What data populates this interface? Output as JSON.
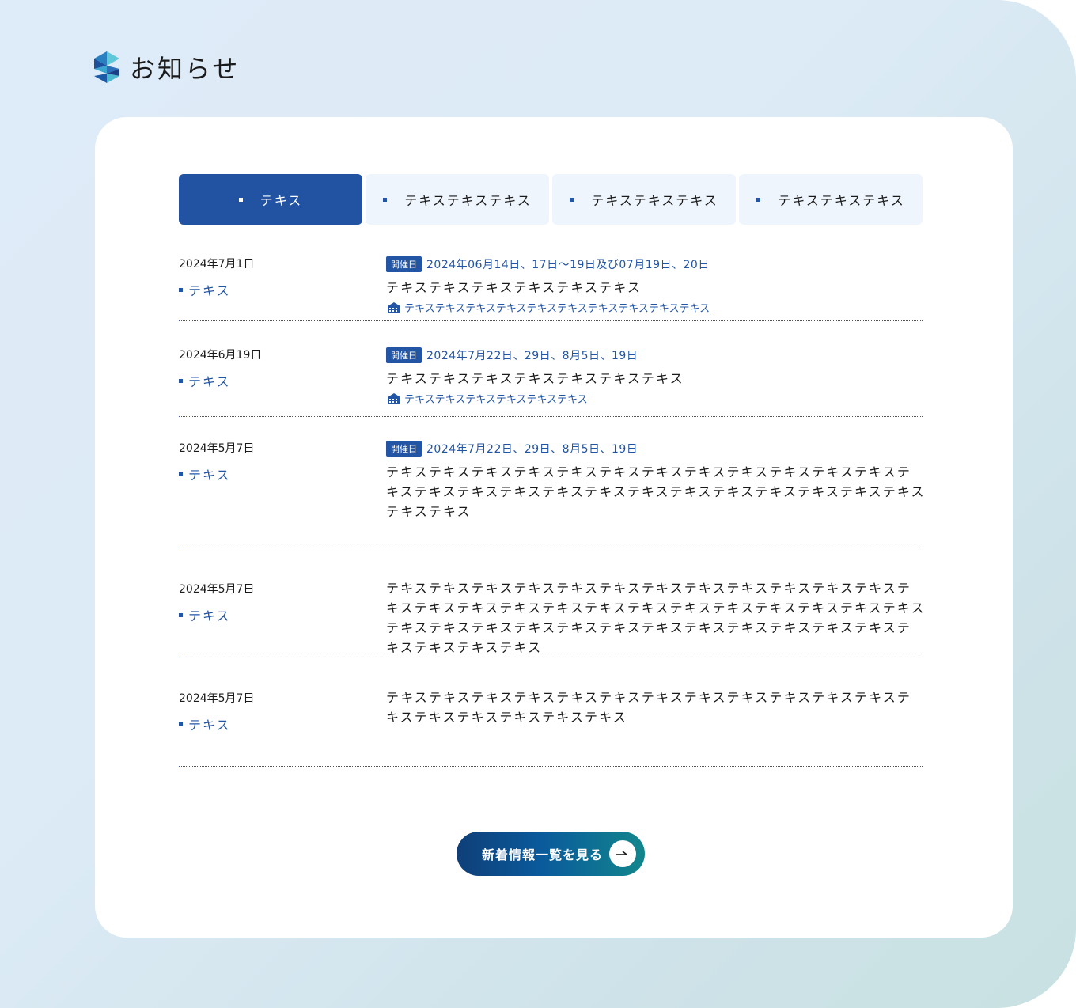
{
  "heading": {
    "title": "お知らせ"
  },
  "tabs": [
    {
      "label": "テキス",
      "active": true
    },
    {
      "label": "テキステキステキス",
      "active": false
    },
    {
      "label": "テキステキステキス",
      "active": false
    },
    {
      "label": "テキステキステキス",
      "active": false
    }
  ],
  "news": [
    {
      "date": "2024年7月1日",
      "category": "テキス",
      "event_badge": "開催日",
      "event_dates": "2024年06月14日、17日〜19日及び07月19日、20日",
      "text": "テキステキステキステキステキステキス",
      "venue_link": "テキステキステキステキステキステキステキステキステキステキス"
    },
    {
      "date": "2024年6月19日",
      "category": "テキス",
      "event_badge": "開催日",
      "event_dates": "2024年7月22日、29日、8月5日、19日",
      "text": "テキステキステキステキステキステキステキス",
      "venue_link": "テキステキステキステキステキステキス"
    },
    {
      "date": "2024年5月7日",
      "category": "テキス",
      "event_badge": "開催日",
      "event_dates": "2024年7月22日、29日、8月5日、19日",
      "text": "テキステキステキステキステキステキステキステキステキステキステキステキステキステキステキステキステキステキステキステキステキステキステキステキステキステキステキス"
    },
    {
      "date": "2024年5月7日",
      "category": "テキス",
      "text": "テキステキステキステキステキステキステキステキステキステキステキステキステキステキステキステキステキステキステキステキステキステキステキステキステキステキステキステキステキステキステキステキステキステキステキステキステキステキステキステキステキス"
    },
    {
      "date": "2024年5月7日",
      "category": "テキス",
      "text": "テキステキステキステキステキステキステキステキステキステキステキステキステキステキステキステキステキステキス"
    }
  ],
  "more_button": {
    "label": "新着情報一覧を見る"
  },
  "colors": {
    "primary": "#2255a4",
    "active_tab": "#2252a2",
    "tab_bg": "#eef5fd",
    "button_start": "#0f3f78",
    "button_end": "#12868c"
  }
}
